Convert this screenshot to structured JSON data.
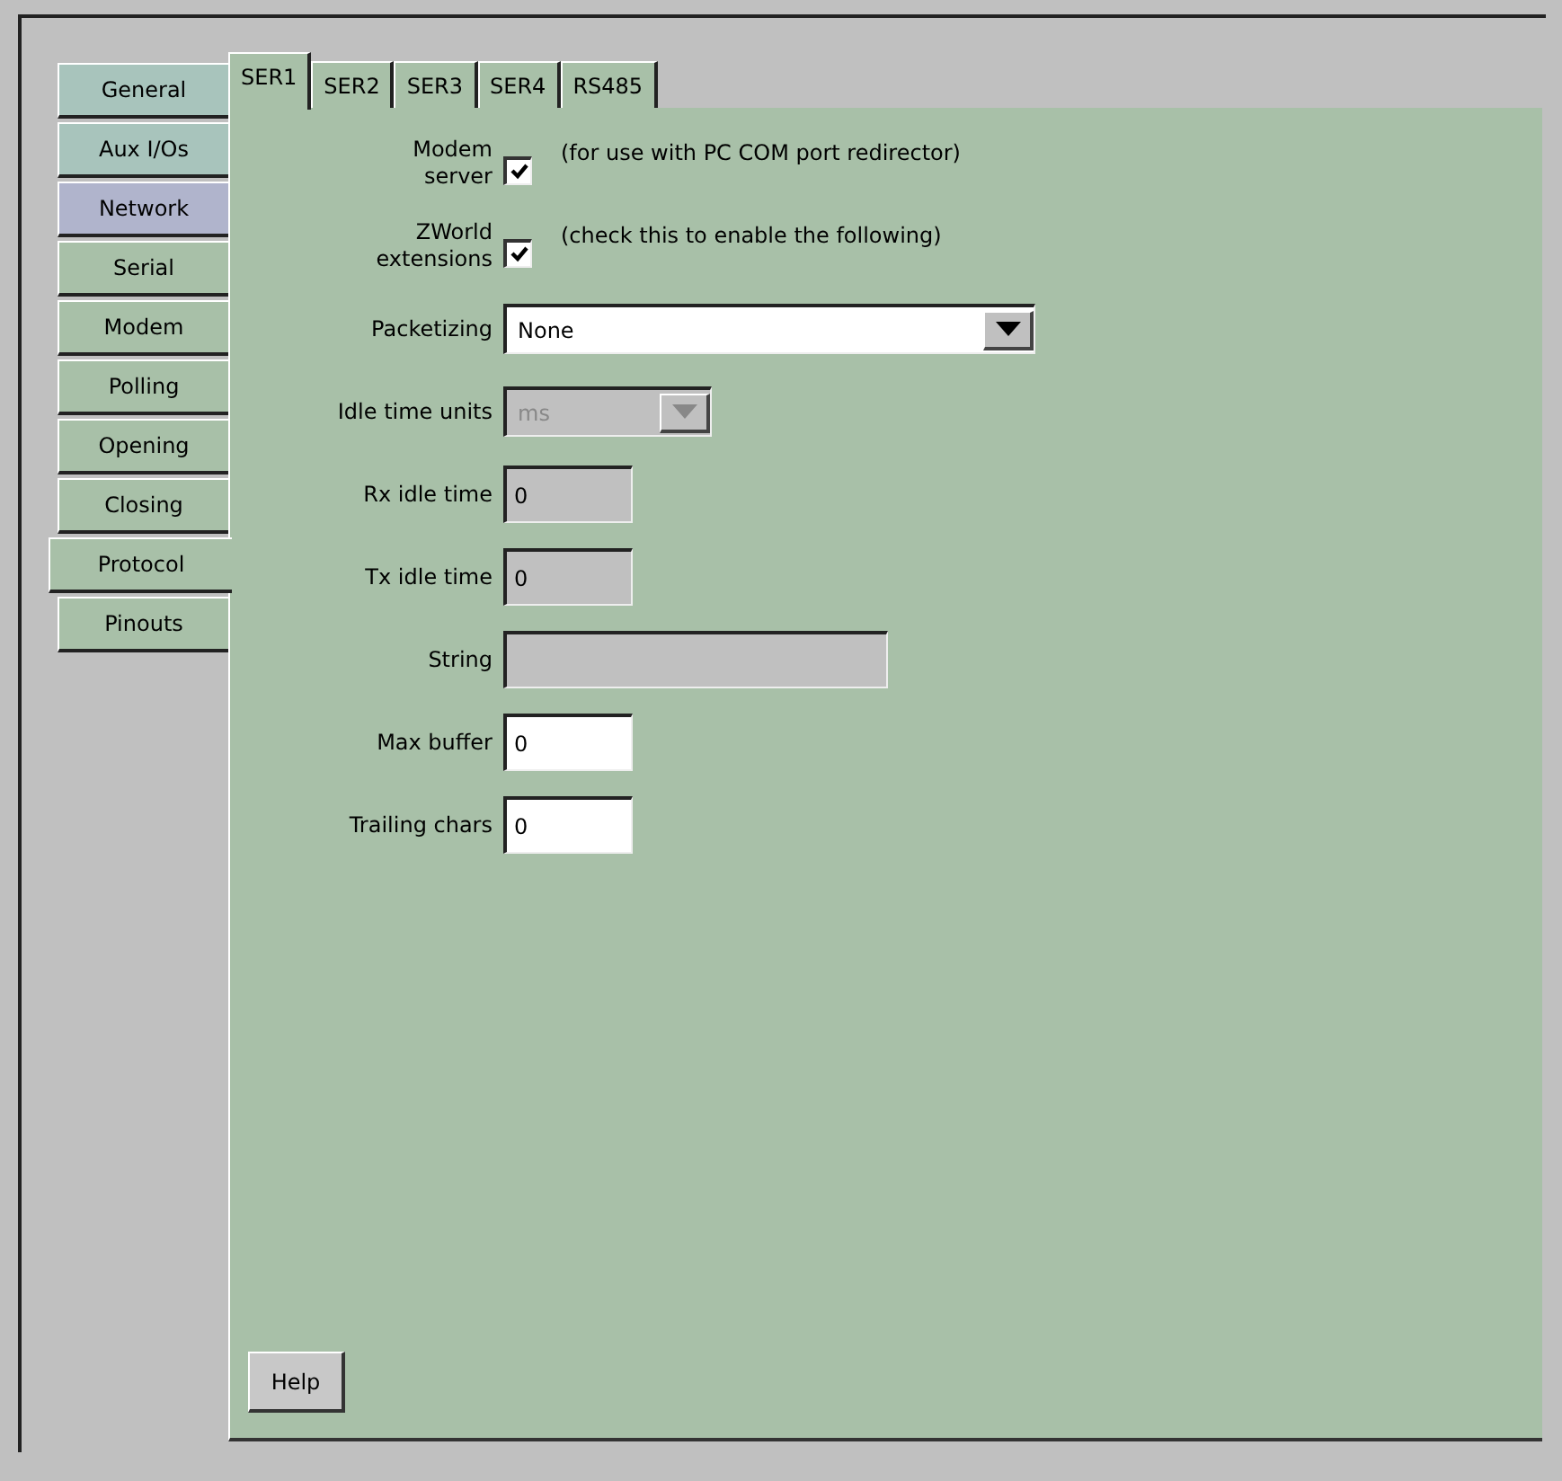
{
  "side_tabs": [
    {
      "label": "General",
      "selected": false,
      "color": "#a8c4bc"
    },
    {
      "label": "Aux I/Os",
      "selected": false,
      "color": "#a8c4bc"
    },
    {
      "label": "Network",
      "selected": false,
      "color": "#b0b4cc"
    },
    {
      "label": "Serial",
      "selected": false,
      "color": "#a8c0a8"
    },
    {
      "label": "Modem",
      "selected": false,
      "color": "#a8c0a8"
    },
    {
      "label": "Polling",
      "selected": false,
      "color": "#a8c0a8"
    },
    {
      "label": "Opening",
      "selected": false,
      "color": "#a8c0a8"
    },
    {
      "label": "Closing",
      "selected": false,
      "color": "#a8c0a8"
    },
    {
      "label": "Protocol",
      "selected": true,
      "color": "#a8c0a8"
    },
    {
      "label": "Pinouts",
      "selected": false,
      "color": "#a8c0a8"
    }
  ],
  "top_tabs": [
    {
      "label": "SER1",
      "selected": true
    },
    {
      "label": "SER2",
      "selected": false
    },
    {
      "label": "SER3",
      "selected": false
    },
    {
      "label": "SER4",
      "selected": false
    },
    {
      "label": "RS485",
      "selected": false
    }
  ],
  "fields": [
    {
      "kind": "checkbox",
      "label": [
        "Modem",
        "server"
      ],
      "checked": true,
      "note": "(for use with PC COM port redirector)"
    },
    {
      "kind": "checkbox",
      "label": [
        "ZWorld",
        "extensions"
      ],
      "checked": true,
      "note": "(check this to enable the following)"
    },
    {
      "kind": "dropdown",
      "label": [
        "Packetizing"
      ],
      "value": "None",
      "disabled": false,
      "wide": true
    },
    {
      "kind": "dropdown",
      "label": [
        "Idle time units"
      ],
      "value": "ms",
      "disabled": true,
      "wide": false
    },
    {
      "kind": "text",
      "label": [
        "Rx idle time"
      ],
      "value": "0",
      "disabled": true,
      "wide": false
    },
    {
      "kind": "text",
      "label": [
        "Tx idle time"
      ],
      "value": "0",
      "disabled": true,
      "wide": false
    },
    {
      "kind": "text",
      "label": [
        "String"
      ],
      "disabled": true,
      "wide": true
    },
    {
      "kind": "text",
      "label": [
        "Max buffer"
      ],
      "value": "0",
      "disabled": false,
      "wide": false
    },
    {
      "kind": "text",
      "label": [
        "Trailing chars"
      ],
      "value": "0",
      "disabled": false,
      "wide": false
    }
  ],
  "help_button": "Help"
}
